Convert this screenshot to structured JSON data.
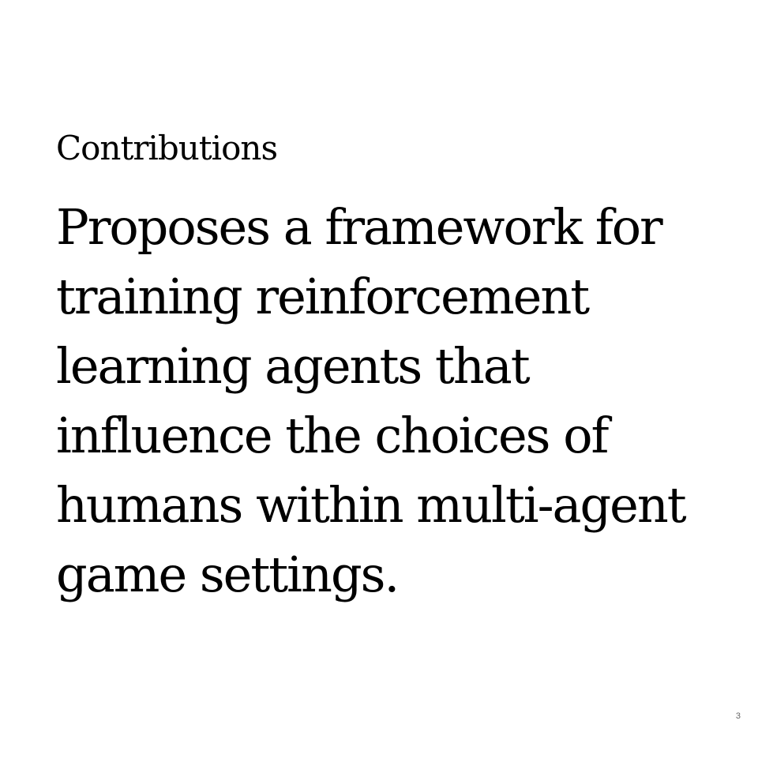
{
  "slide": {
    "heading": "Contributions",
    "body_lines": [
      "Proposes a framework for",
      "training reinforcement",
      "learning agents that",
      "influence the choices of",
      "humans within multi-agent",
      "game settings."
    ],
    "page_number": "3"
  }
}
